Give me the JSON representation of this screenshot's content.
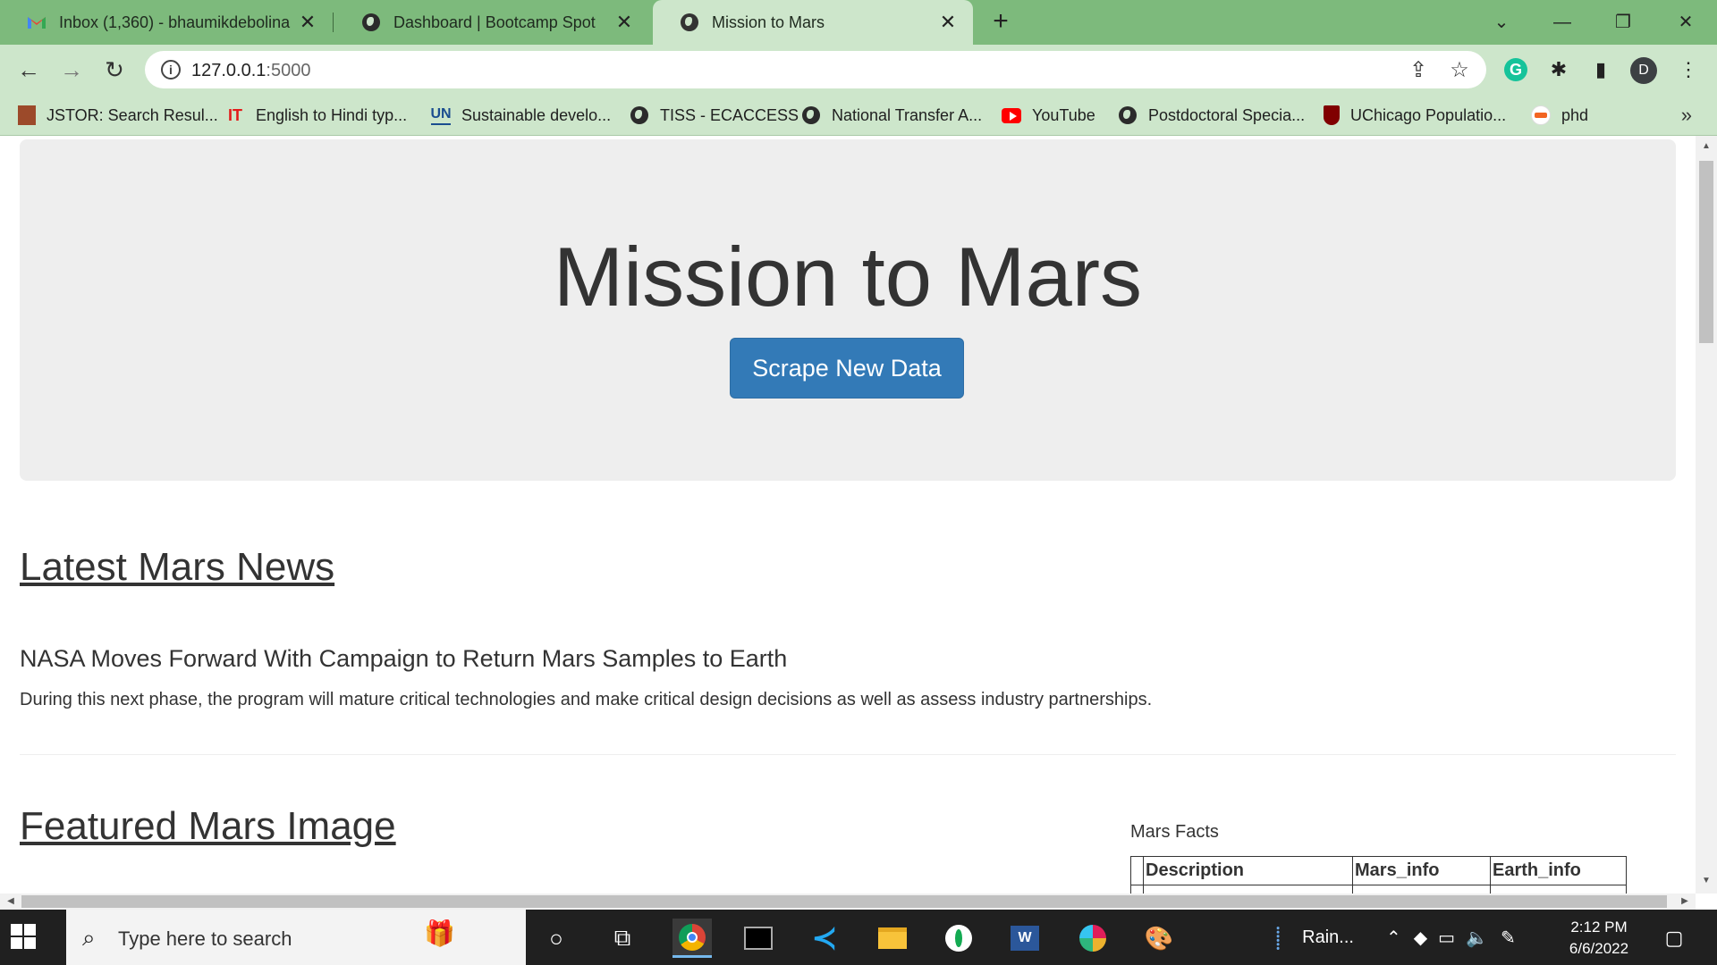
{
  "browser": {
    "tabs": [
      {
        "title": "Inbox (1,360) - bhaumikdebolina",
        "icon": "gmail-icon"
      },
      {
        "title": "Dashboard | Bootcamp Spot",
        "icon": "globe-icon"
      },
      {
        "title": "Mission to Mars",
        "icon": "globe-icon",
        "active": true
      }
    ],
    "url_host": "127.0.0.1",
    "url_port": ":5000",
    "profile_initial": "D",
    "bookmarks": [
      {
        "label": "JSTOR: Search Resul...",
        "icon": "jstor-icon"
      },
      {
        "label": "English to Hindi typ...",
        "icon": "it-icon",
        "icon_text": "IT"
      },
      {
        "label": "Sustainable develo...",
        "icon": "un-icon",
        "icon_text": "UN"
      },
      {
        "label": "TISS - ECACCESS",
        "icon": "globe-icon"
      },
      {
        "label": "National Transfer A...",
        "icon": "globe-icon"
      },
      {
        "label": "YouTube",
        "icon": "youtube-icon"
      },
      {
        "label": "Postdoctoral Specia...",
        "icon": "globe-icon"
      },
      {
        "label": "UChicago Populatio...",
        "icon": "uchicago-icon"
      },
      {
        "label": "phd",
        "icon": "phd-icon"
      }
    ]
  },
  "page": {
    "title": "Mission to Mars",
    "scrape_button": "Scrape New Data",
    "news_heading": "Latest Mars News",
    "news_title": "NASA Moves Forward With Campaign to Return Mars Samples to Earth",
    "news_paragraph": "During this next phase, the program will mature critical technologies and make critical design decisions as well as assess industry partnerships.",
    "image_heading": "Featured Mars Image",
    "facts_caption": "Mars Facts",
    "facts_headers": [
      "Description",
      "Mars_info",
      "Earth_info"
    ]
  },
  "taskbar": {
    "search_placeholder": "Type here to search",
    "weather": "Rain...",
    "time": "2:12 PM",
    "date": "6/6/2022"
  },
  "colors": {
    "tabstrip": "#7dba7c",
    "toolbar": "#cde6cb",
    "button_primary": "#337ab7",
    "jumbotron": "#eeeeee"
  }
}
